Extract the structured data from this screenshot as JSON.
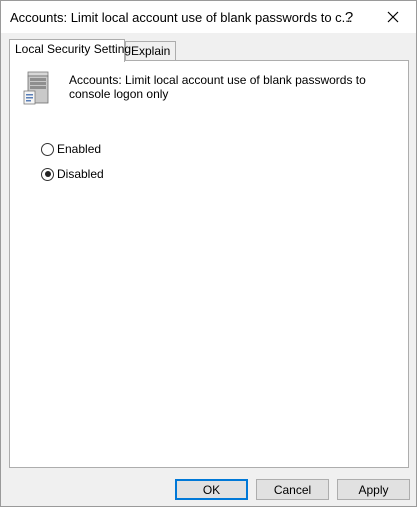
{
  "window": {
    "title": "Accounts: Limit local account use of blank passwords to c...",
    "help_label": "?",
    "close_icon": "close-icon"
  },
  "tabs": [
    {
      "label": "Local Security Setting",
      "active": true
    },
    {
      "label": "Explain",
      "active": false
    }
  ],
  "policy": {
    "icon": "server-policy-icon",
    "title": "Accounts: Limit local account use of blank passwords to console logon only"
  },
  "options": {
    "enabled_label": "Enabled",
    "disabled_label": "Disabled",
    "selected": "Disabled"
  },
  "buttons": {
    "ok_label": "OK",
    "cancel_label": "Cancel",
    "apply_label": "Apply"
  },
  "colors": {
    "accent": "#0078d7",
    "panel_bg": "#ffffff",
    "dialog_bg": "#f0f0f0"
  }
}
